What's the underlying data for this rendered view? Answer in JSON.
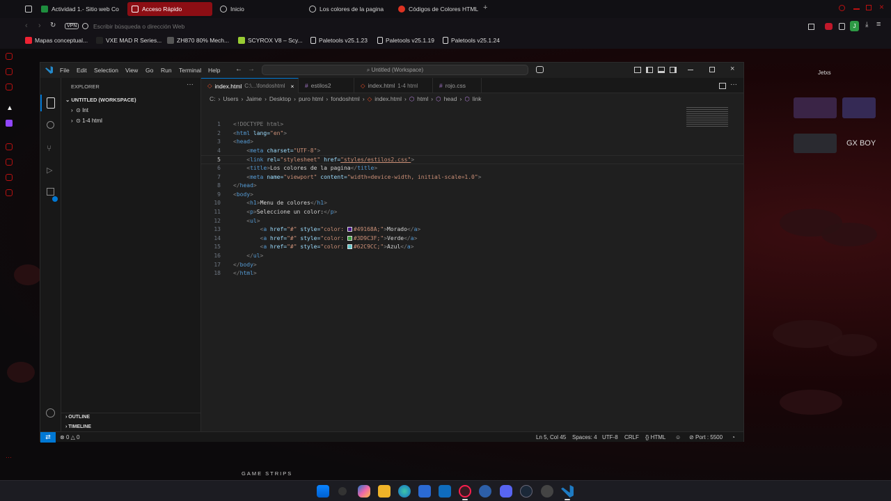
{
  "browser": {
    "tabs": [
      {
        "label": "Actividad 1.- Sitio web Co"
      },
      {
        "label": "Acceso Rápido"
      },
      {
        "label": "Inicio"
      },
      {
        "label": "Los colores de la pagina"
      },
      {
        "label": "Códigos de Colores HTML"
      }
    ],
    "address_placeholder": "Escribir búsqueda o dirección Web",
    "vpn_label": "VPN",
    "bookmarks": [
      "Mapas conceptual...",
      "VXE MAD R Series...",
      "ZH870 80% Mech...",
      "SCYROX V8 – Scy...",
      "Paletools v25.1.23",
      "Paletools v25.1.19",
      "Paletools v25.1.24"
    ],
    "profile_initial": "J"
  },
  "vscode": {
    "menu": [
      "File",
      "Edit",
      "Selection",
      "View",
      "Go",
      "Run",
      "Terminal",
      "Help"
    ],
    "command_center": "Untitled (Workspace)",
    "sidebar": {
      "title": "EXPLORER",
      "workspace": "UNTITLED (WORKSPACE)",
      "folders": [
        "Int",
        "1-4 html"
      ],
      "outline": "OUTLINE",
      "timeline": "TIMELINE"
    },
    "tabs": [
      {
        "name": "index.html",
        "desc": "C:\\...\\fondoshtml",
        "active": true
      },
      {
        "name": "estilos2",
        "desc": ""
      },
      {
        "name": "index.html",
        "desc": "1-4 html"
      },
      {
        "name": "rojo.css",
        "desc": ""
      }
    ],
    "breadcrumbs": [
      "C:",
      "Users",
      "Jaime",
      "Desktop",
      "puro html",
      "fondoshtml",
      "index.html",
      "html",
      "head",
      "link"
    ],
    "code_lines": [
      {
        "n": "1"
      },
      {
        "n": "2"
      },
      {
        "n": "3"
      },
      {
        "n": "4"
      },
      {
        "n": "5"
      },
      {
        "n": "6"
      },
      {
        "n": "7"
      },
      {
        "n": "8"
      },
      {
        "n": "9"
      },
      {
        "n": "10"
      },
      {
        "n": "11"
      },
      {
        "n": "12"
      },
      {
        "n": "13"
      },
      {
        "n": "14"
      },
      {
        "n": "15"
      },
      {
        "n": "16"
      },
      {
        "n": "17"
      },
      {
        "n": "18"
      }
    ],
    "code": {
      "doctype": "<!DOCTYPE html>",
      "html_open": "html",
      "lang_attr": "lang=",
      "lang_val": "\"en\"",
      "head_open": "head",
      "meta": "meta",
      "charset_attr": "charset=",
      "charset_val": "\"UTF-8\"",
      "link": "link",
      "rel_attr": "rel=",
      "rel_val": "\"stylesheet\"",
      "href_attr": "href=",
      "href_val": "\"styles/estilos2.css\"",
      "title_tag": "title",
      "title_text": "Los colores de la pagina",
      "name_attr": "name=",
      "name_val": "\"viewport\"",
      "content_attr": "content=",
      "content_val": "\"width=device-width, initial-scale=1.0\"",
      "head_close": "head",
      "body_open": "body",
      "h1": "h1",
      "h1_text": "Menu de colores",
      "p": "p",
      "p_text": "Seleccione un color:",
      "ul": "ul",
      "a": "a",
      "a_href": "href=",
      "a_href_val": "\"#\"",
      "style_attr": "style=",
      "links": [
        {
          "style": "\"color: ",
          "hex": "#49168A;\"",
          "text": "Morado",
          "swatch": "#49168A"
        },
        {
          "style": "\"color: ",
          "hex": "#3D9C3F;\"",
          "text": "Verde",
          "swatch": "#3D9C3F"
        },
        {
          "style": "\"color: ",
          "hex": "#62C9CC;\"",
          "text": "Azul",
          "swatch": "#62C9CC"
        }
      ],
      "body_close": "body",
      "html_close": "html"
    },
    "status": {
      "problems": "0",
      "warnings": "0",
      "position": "Ln 5, Col 45",
      "spaces": "Spaces: 4",
      "encoding": "UTF-8",
      "eol": "CRLF",
      "language": "HTML",
      "port": "Port : 5500"
    }
  },
  "desktop": {
    "widget_name": "Jetxs",
    "gx_boy": "GX BOY",
    "game_strips": "GAME STRIPS"
  },
  "colors": {
    "accent": "#0078d4",
    "gx_red": "#8c0e14"
  }
}
